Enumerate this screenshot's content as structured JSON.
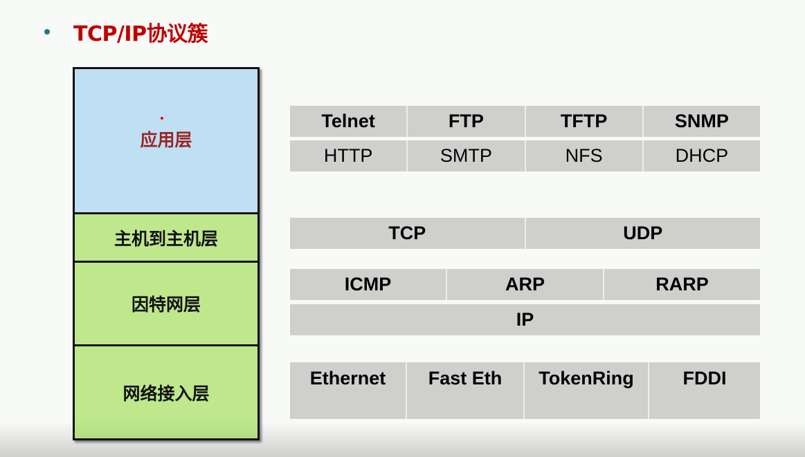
{
  "slide": {
    "title": "TCP/IP协议簇",
    "colors": {
      "title": "#c00000",
      "bullet": "#1f7a8c",
      "application_layer_fill": "#bfe0f3",
      "other_layer_fill": "#bfe88d",
      "protocol_cell_fill": "#cfd0cd"
    }
  },
  "layers": [
    {
      "label": "应用层"
    },
    {
      "label": "主机到主机层"
    },
    {
      "label": "因特网层"
    },
    {
      "label": "网络接入层"
    }
  ],
  "protocols": {
    "application_row1": [
      "Telnet",
      "FTP",
      "TFTP",
      "SNMP"
    ],
    "application_row2": [
      "HTTP",
      "SMTP",
      "NFS",
      "DHCP"
    ],
    "transport": [
      "TCP",
      "UDP"
    ],
    "internet_row1": [
      "ICMP",
      "ARP",
      "RARP"
    ],
    "internet_row2": [
      "IP"
    ],
    "network_access": [
      "Ethernet",
      "Fast Eth",
      "TokenRing",
      "FDDI"
    ]
  }
}
